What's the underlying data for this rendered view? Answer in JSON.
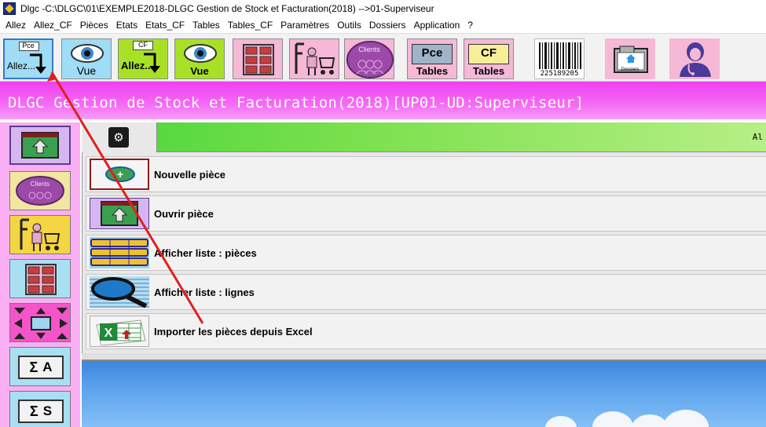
{
  "window": {
    "title": "Dlgc -C:\\DLGC\\01\\EXEMPLE2018-DLGC Gestion de Stock et Facturation(2018) -->01-Superviseur"
  },
  "menu": {
    "items": [
      "Allez",
      "Allez_CF",
      "Pièces",
      "Etats",
      "Etats_CF",
      "Tables",
      "Tables_CF",
      "Paramètres",
      "Outils",
      "Dossiers",
      "Application",
      "?"
    ]
  },
  "toolbar": {
    "pce_small": "Pce",
    "pce_caption": "Allez...",
    "vue_caption": "Vue",
    "cf_small": "CF",
    "cf_caption": "Allez...",
    "vue2_caption": "Vue",
    "clients_label": "Clients",
    "pce_tables_top": "Pce",
    "pce_tables_bottom": "Tables",
    "cf_tables_top": "CF",
    "cf_tables_bottom": "Tables",
    "barcode_number": "225189205",
    "dossiers_label": "Dossiers"
  },
  "banner": {
    "text": "DLGC Gestion de Stock et Facturation(2018)[UP01-UD:Superviseur]"
  },
  "sidebar": {
    "clients_label": "Clients",
    "sigma_a_letter": "A",
    "sigma_s_letter": "S"
  },
  "content": {
    "strip_label": "Al",
    "actions": [
      {
        "label": "Nouvelle pièce"
      },
      {
        "label": "Ouvrir pièce"
      },
      {
        "label": "Afficher liste : pièces"
      },
      {
        "label": "Afficher liste : lignes"
      },
      {
        "label": "Importer les pièces depuis Excel"
      }
    ]
  },
  "colors": {
    "banner": "#f03ff0",
    "sidebar": "#f9aef3",
    "strip_green": "#4ad63a",
    "annotation_arrow": "#e02020"
  },
  "icons": {
    "title": "app-icon",
    "gear": "gear-icon",
    "eye": "eye-icon",
    "barcode": "barcode-icon",
    "folder": "folder-icon",
    "user": "doctor-user-icon"
  }
}
